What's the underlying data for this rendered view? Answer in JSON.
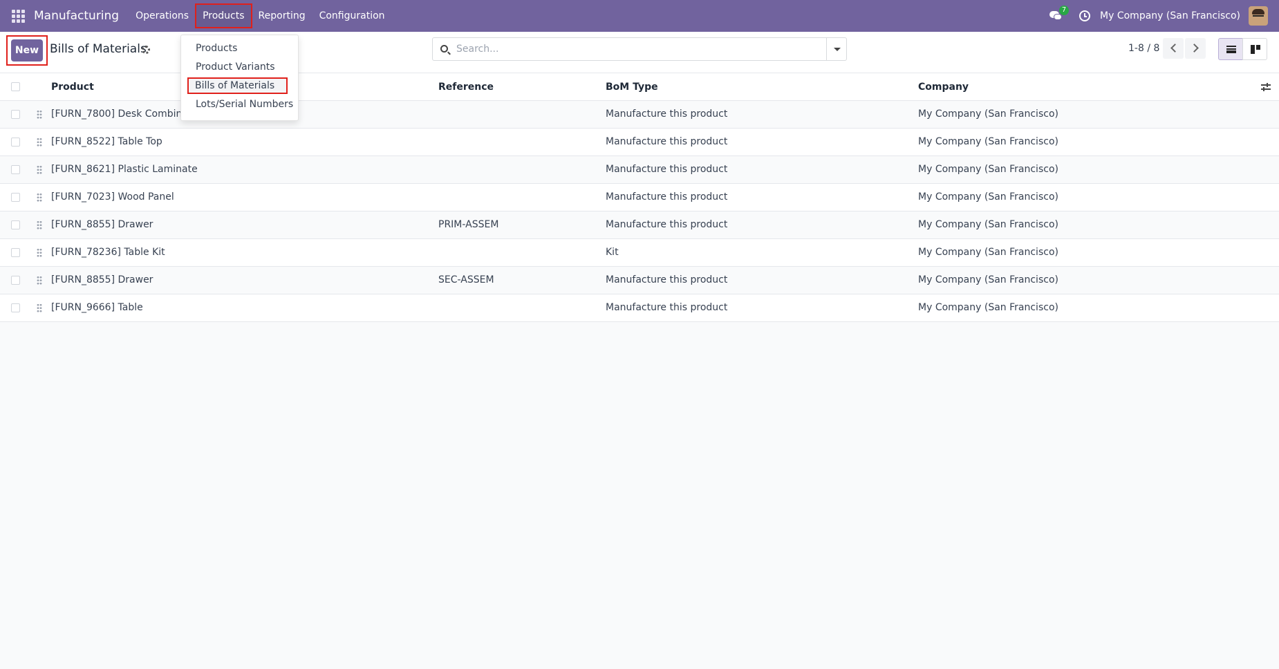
{
  "navbar": {
    "app_name": "Manufacturing",
    "menu": [
      "Operations",
      "Products",
      "Reporting",
      "Configuration"
    ],
    "active_menu": "Products",
    "chat_badge": "7",
    "company": "My Company (San Francisco)"
  },
  "products_menu": {
    "items": [
      "Products",
      "Product Variants",
      "Bills of Materials",
      "Lots/Serial Numbers"
    ],
    "highlighted": "Bills of Materials"
  },
  "control": {
    "new_label": "New",
    "title": "Bills of Materials",
    "search_placeholder": "Search...",
    "pager": "1-8 / 8"
  },
  "table": {
    "columns": [
      "Product",
      "Reference",
      "BoM Type",
      "Company"
    ],
    "rows": [
      {
        "product": "[FURN_7800] Desk Combinati",
        "reference": "",
        "bom_type": "Manufacture this product",
        "company": "My Company (San Francisco)"
      },
      {
        "product": "[FURN_8522] Table Top",
        "reference": "",
        "bom_type": "Manufacture this product",
        "company": "My Company (San Francisco)"
      },
      {
        "product": "[FURN_8621] Plastic Laminate",
        "reference": "",
        "bom_type": "Manufacture this product",
        "company": "My Company (San Francisco)"
      },
      {
        "product": "[FURN_7023] Wood Panel",
        "reference": "",
        "bom_type": "Manufacture this product",
        "company": "My Company (San Francisco)"
      },
      {
        "product": "[FURN_8855] Drawer",
        "reference": "PRIM-ASSEM",
        "bom_type": "Manufacture this product",
        "company": "My Company (San Francisco)"
      },
      {
        "product": "[FURN_78236] Table Kit",
        "reference": "",
        "bom_type": "Kit",
        "company": "My Company (San Francisco)"
      },
      {
        "product": "[FURN_8855] Drawer",
        "reference": "SEC-ASSEM",
        "bom_type": "Manufacture this product",
        "company": "My Company (San Francisco)"
      },
      {
        "product": "[FURN_9666] Table",
        "reference": "",
        "bom_type": "Manufacture this product",
        "company": "My Company (San Francisco)"
      }
    ]
  }
}
